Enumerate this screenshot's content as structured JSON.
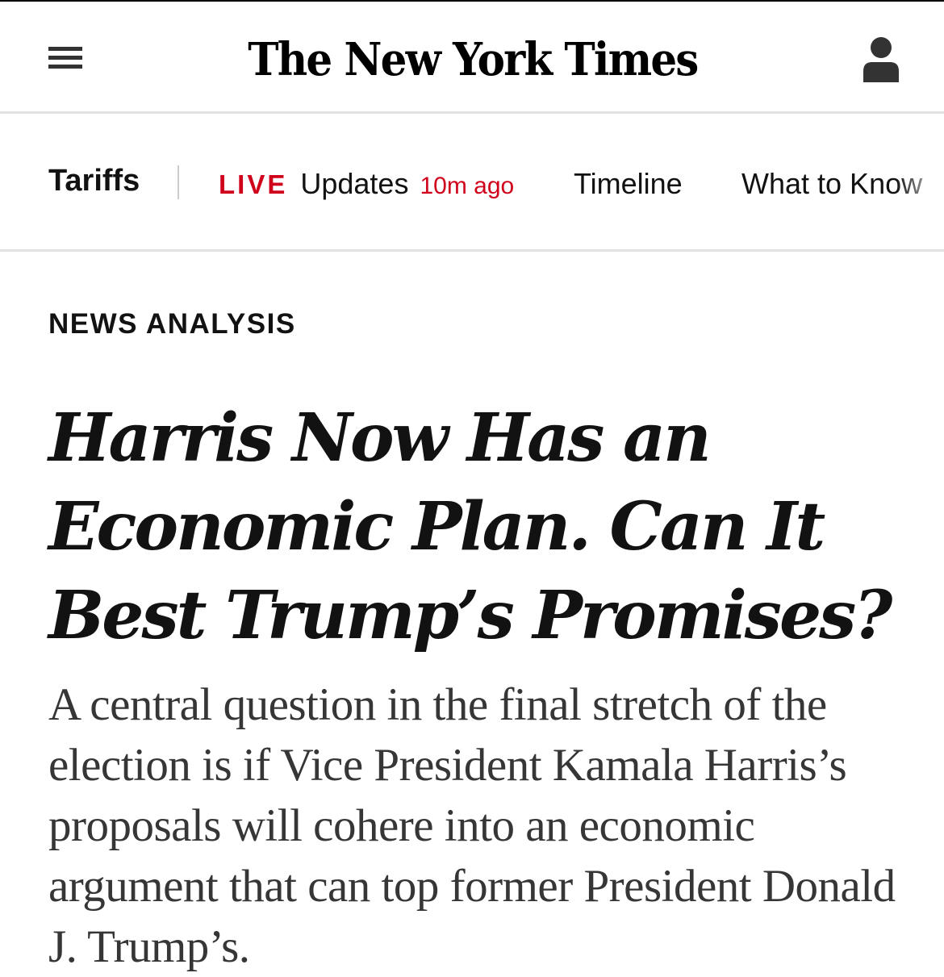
{
  "header": {
    "logo_text": "The New York Times"
  },
  "subnav": {
    "section": "Tariffs",
    "live_badge": "LIVE",
    "live_label": "Updates",
    "live_time": "10m ago",
    "items": [
      {
        "label": "Timeline"
      },
      {
        "label": "What to Know"
      }
    ]
  },
  "article": {
    "kicker": "NEWS ANALYSIS",
    "headline": "Harris Now Has an Economic Plan. Can It Best Trump’s Promises?",
    "summary": "A central question in the final stretch of the election is if Vice President Kamala Harris’s proposals will cohere into an economic argument that can top former President Donald J. Trump’s."
  },
  "colors": {
    "live_red": "#d0021b",
    "text": "#121212",
    "summary_text": "#363636",
    "divider": "#e2e2e2"
  },
  "icons": {
    "menu": "hamburger-menu-icon",
    "account": "user-account-icon"
  }
}
